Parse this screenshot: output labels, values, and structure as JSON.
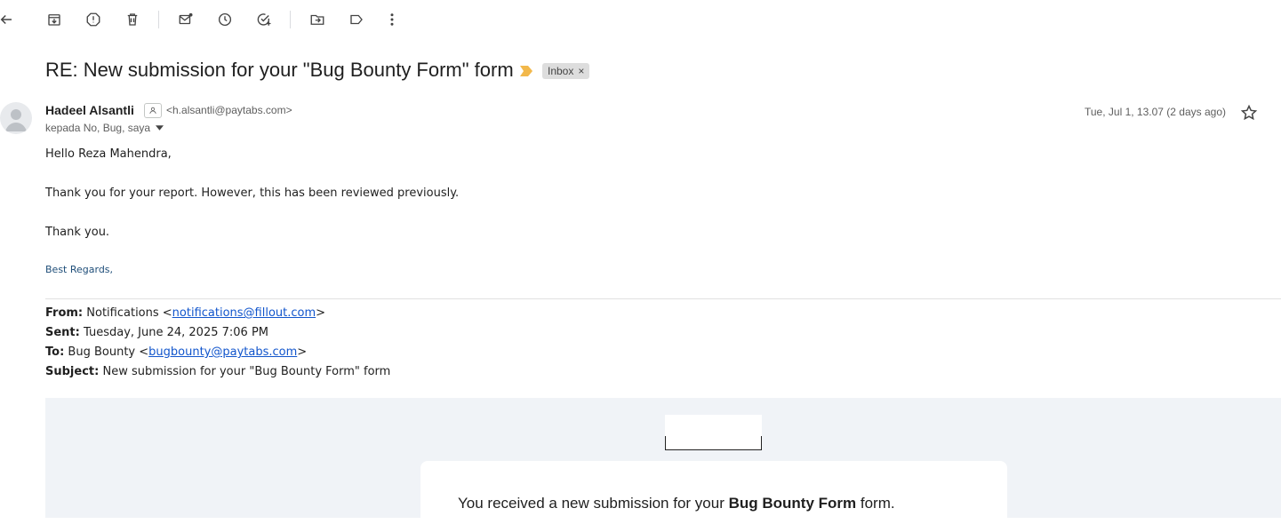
{
  "toolbar": {
    "back": "back-arrow-icon",
    "icons": [
      "archive-icon",
      "report-spam-icon",
      "delete-icon",
      "mark-unread-icon",
      "snooze-icon",
      "add-task-icon",
      "move-to-icon",
      "label-icon",
      "more-vert-icon"
    ]
  },
  "email": {
    "subject": "RE: New submission for your \"Bug Bounty Form\" form",
    "label_chip": "Inbox",
    "label_chip_remove": "×",
    "sender_name": "Hadeel Alsantli",
    "sender_email": "<h.alsantli@paytabs.com>",
    "recipients": "kepada No, Bug, saya",
    "date": "Tue, Jul 1, 13.07 (2 days ago)",
    "body": {
      "greeting": "Hello Reza Mahendra,",
      "line1": "Thank you for your report. However, this has been reviewed previously.",
      "line2": "Thank you.",
      "regards": "Best Regards,"
    },
    "quoted": {
      "from_label": "From:",
      "from_name": "Notifications <",
      "from_email": "notifications@fillout.com",
      "from_end": ">",
      "sent_label": "Sent:",
      "sent_value": "Tuesday, June 24, 2025 7:06 PM",
      "to_label": "To:",
      "to_name": "Bug Bounty <",
      "to_email": "bugbounty@paytabs.com",
      "to_end": ">",
      "subject_label": "Subject:",
      "subject_value": "New submission for your \"Bug Bounty Form\" form"
    },
    "card": {
      "prefix": "You received a new submission for your ",
      "form_name": "Bug Bounty Form",
      "suffix": " form."
    }
  },
  "colors": {
    "importance_marker": "#f2b84b",
    "link": "#1155cc",
    "regards": "#1f4e79",
    "panel_bg": "#f0f3f7"
  }
}
